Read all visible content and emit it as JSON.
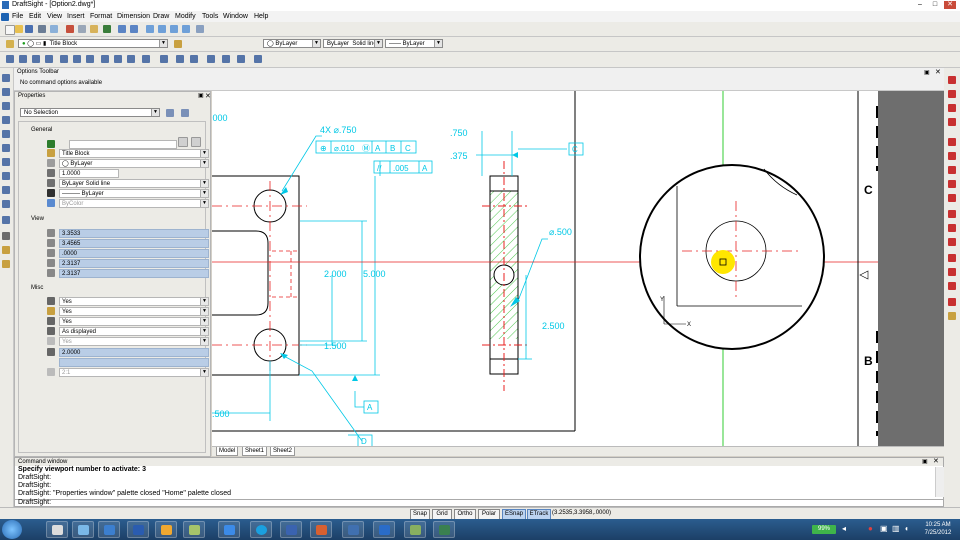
{
  "app": {
    "title": "DraftSight - [Option2.dwg*]"
  },
  "menu": [
    "File",
    "Edit",
    "View",
    "Insert",
    "Format",
    "Dimension",
    "Draw",
    "Modify",
    "Tools",
    "Window",
    "Help"
  ],
  "toolbar": {
    "layer": "Title Block",
    "color": "ByLayer",
    "linestyle": "ByLayer",
    "lineweight": "Solid line",
    "lineweight2": "ByLayer"
  },
  "options_toolbar": {
    "title": "Options Toolbar",
    "message": "No command options available"
  },
  "properties": {
    "title": "Properties",
    "selection": "No Selection",
    "general_label": "General",
    "general": [
      {
        "value": "",
        "dropdown": false,
        "disabled": false
      },
      {
        "value": "Title Block",
        "dropdown": true,
        "disabled": false
      },
      {
        "value": "ByLayer",
        "dropdown": true,
        "disabled": false
      },
      {
        "value": "1.0000",
        "dropdown": false,
        "disabled": false
      },
      {
        "value": "ByLayer     Solid line",
        "dropdown": true,
        "disabled": false
      },
      {
        "value": "——— ByLayer",
        "dropdown": true,
        "disabled": false
      },
      {
        "value": "ByColor",
        "dropdown": true,
        "disabled": true
      }
    ],
    "view_label": "View",
    "view": [
      "3.3533",
      "3.4565",
      ".0000",
      "2.3137",
      "2.3137"
    ],
    "misc_label": "Misc",
    "misc": [
      {
        "value": "Yes",
        "dropdown": true,
        "disabled": false
      },
      {
        "value": "Yes",
        "dropdown": true,
        "disabled": false
      },
      {
        "value": "Yes",
        "dropdown": true,
        "disabled": false
      },
      {
        "value": "As displayed",
        "dropdown": true,
        "disabled": false
      },
      {
        "value": "Yes",
        "dropdown": true,
        "disabled": true
      },
      {
        "value": "2.0000",
        "dropdown": false,
        "disabled": false,
        "blue": true
      },
      {
        "value": "",
        "dropdown": false,
        "disabled": false,
        "blue": true
      },
      {
        "value": "2:1",
        "dropdown": true,
        "disabled": true
      }
    ]
  },
  "drawing": {
    "dims": {
      "d1000": ".000",
      "hole_callout": "4X  ⌀.750",
      "fcf1": [
        "⊕",
        "⌀.010",
        "Ⓜ",
        "A",
        "B",
        "C"
      ],
      "fcf2": [
        "//",
        ".005",
        "A"
      ],
      "d2000": "2.000",
      "d5000": "5.000",
      "d1500": "1.500",
      "d500": ".500",
      "d750": ".750",
      "d375": ".375",
      "d_500dia": "⌀.500",
      "d2500": "2.500",
      "datum_a": "A",
      "datum_b": "B",
      "datum_c": "C",
      "datum_d": "D"
    },
    "title_letters": [
      "C",
      "B"
    ],
    "ucs_x": "X",
    "ucs_y": "Y"
  },
  "tabs": [
    "Model",
    "Sheet1",
    "Sheet2"
  ],
  "command": {
    "title": "Command window",
    "lines": [
      "Specify viewport number to activate: 3",
      "DraftSight:",
      "DraftSight:",
      "DraftSight: \"Properties window\" palette closed \"Home\" palette closed"
    ],
    "prompt": "DraftSight:"
  },
  "status": {
    "buttons": [
      "Snap",
      "Grid",
      "Ortho",
      "Polar",
      "ESnap",
      "ETrack"
    ],
    "active": [
      false,
      false,
      false,
      false,
      true,
      true
    ],
    "coords": "(3.2535,3.3958,.0000)"
  },
  "taskbar": {
    "battery": "99%",
    "time": "10:25 AM",
    "date": "7/25/2012"
  },
  "colors": {
    "cyan": "#00c8e6",
    "red": "#e82020",
    "green": "#00c000",
    "hatch": "#50c850"
  }
}
